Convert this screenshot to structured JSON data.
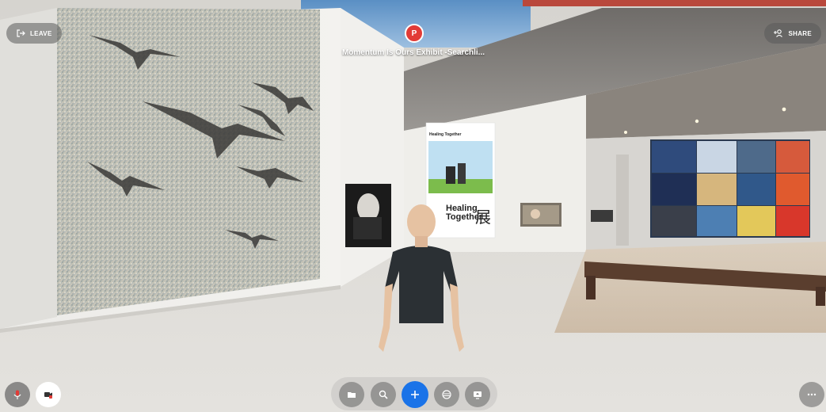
{
  "header": {
    "leave_label": "LEAVE",
    "share_label": "SHARE",
    "space_initial": "P",
    "space_title": "Momentum Is Ours Exhibit -Searchli..."
  },
  "poster": {
    "title": "Healing Together",
    "headline_en": "Healing\nTogether",
    "headline_cjk": "展"
  },
  "icons": {
    "leave": "exit-icon",
    "share": "add-person-icon",
    "mic": "microphone-icon",
    "camera": "camera-off-icon",
    "media": "media-icon",
    "search": "search-icon",
    "add": "plus-icon",
    "emoji": "reaction-icon",
    "screen": "screen-share-icon",
    "more": "more-icon"
  },
  "colors": {
    "accent_blue": "#1a73e8",
    "badge_red": "#e23b36"
  }
}
